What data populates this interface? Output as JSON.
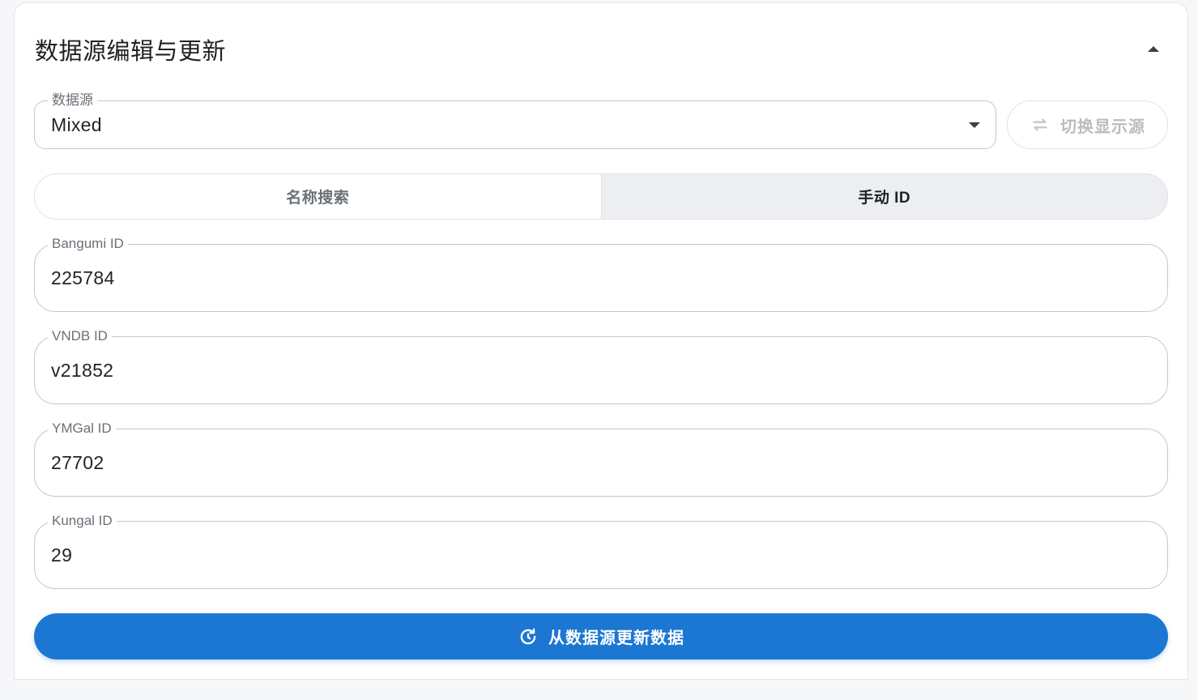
{
  "panel": {
    "title": "数据源编辑与更新"
  },
  "source": {
    "label": "数据源",
    "value": "Mixed"
  },
  "switch_button": {
    "label": "切换显示源"
  },
  "tabs": [
    {
      "label": "名称搜索",
      "active": false
    },
    {
      "label": "手动 ID",
      "active": true
    }
  ],
  "ids": {
    "bangumi": {
      "label": "Bangumi ID",
      "value": "225784"
    },
    "vndb": {
      "label": "VNDB ID",
      "value": "v21852"
    },
    "ymgal": {
      "label": "YMGal ID",
      "value": "27702"
    },
    "kungal": {
      "label": "Kungal ID",
      "value": "29"
    }
  },
  "update_button": {
    "label": "从数据源更新数据"
  },
  "colors": {
    "primary": "#1b77d2",
    "disabled_text": "#b9bcc1",
    "active_tab_bg": "#eceef1"
  },
  "icons": {
    "switch": "swap-horizontal-icon",
    "update": "refresh-icon",
    "collapse": "chevron-up-icon",
    "dropdown": "chevron-down-icon"
  }
}
